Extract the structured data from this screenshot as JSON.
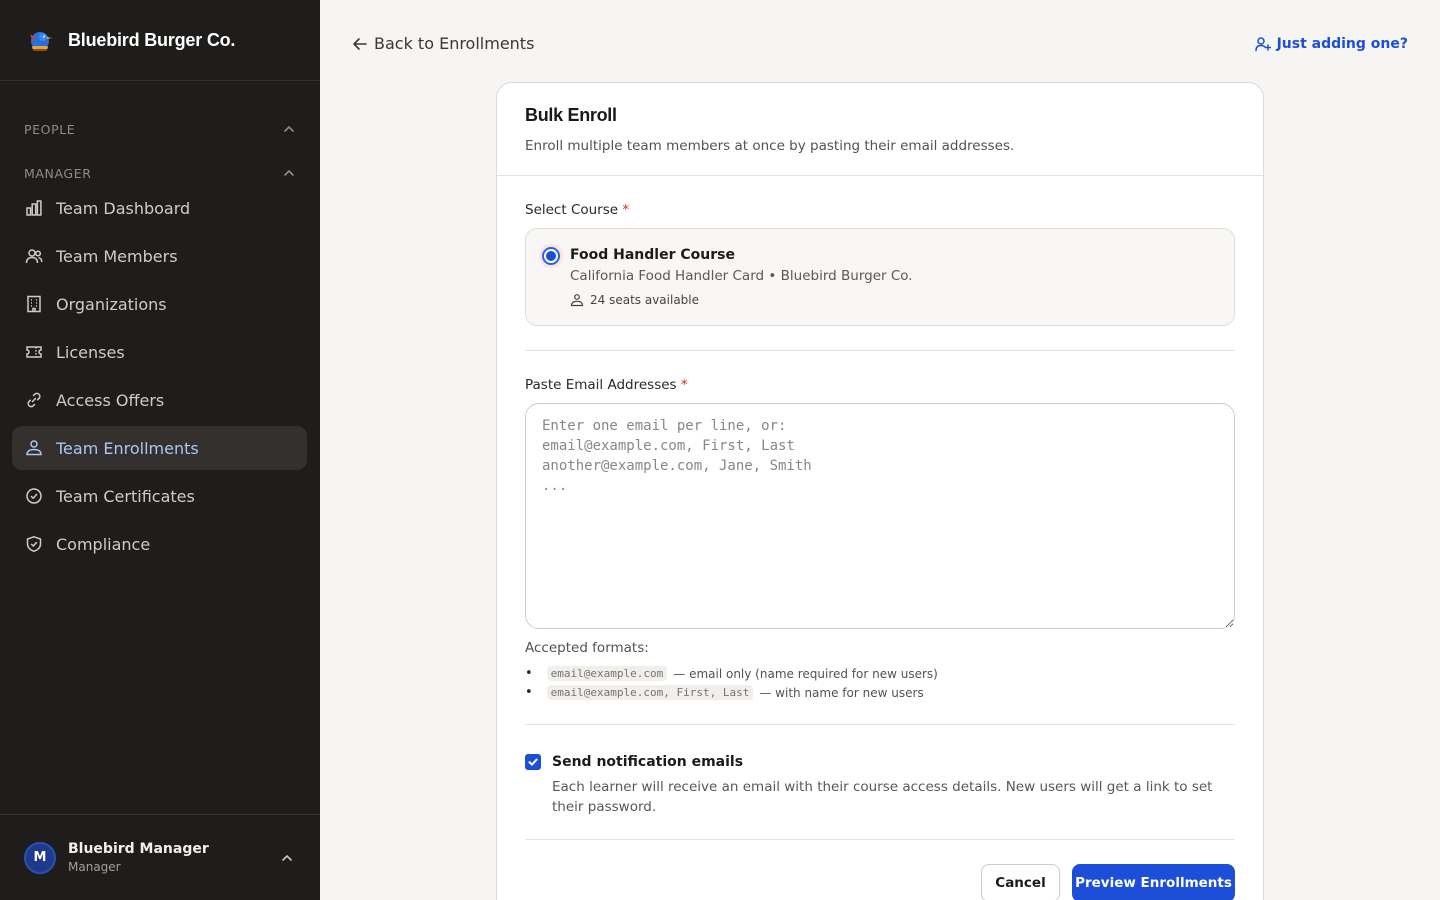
{
  "brand": {
    "name": "Bluebird Burger Co."
  },
  "sidebar": {
    "sections": [
      {
        "label": "PEOPLE"
      },
      {
        "label": "MANAGER"
      }
    ],
    "items": [
      {
        "label": "Team Dashboard",
        "icon": "bar-chart-icon"
      },
      {
        "label": "Team Members",
        "icon": "users-icon"
      },
      {
        "label": "Organizations",
        "icon": "building-icon"
      },
      {
        "label": "Licenses",
        "icon": "ticket-icon"
      },
      {
        "label": "Access Offers",
        "icon": "link-icon"
      },
      {
        "label": "Team Enrollments",
        "icon": "enrollments-icon",
        "active": true
      },
      {
        "label": "Team Certificates",
        "icon": "check-circle-icon"
      },
      {
        "label": "Compliance",
        "icon": "shield-check-icon"
      }
    ],
    "user": {
      "initial": "M",
      "name": "Bluebird Manager",
      "role": "Manager"
    }
  },
  "topbar": {
    "back_label": "Back to Enrollments",
    "just_adding_label": "Just adding one?"
  },
  "card": {
    "title": "Bulk Enroll",
    "subtitle": "Enroll multiple team members at once by pasting their email addresses.",
    "course_label": "Select Course",
    "course": {
      "title": "Food Handler Course",
      "subtitle": "California Food Handler Card • Bluebird Burger Co.",
      "seats": "24 seats available",
      "selected": true
    },
    "emails_label": "Paste Email Addresses",
    "emails_value": "",
    "emails_placeholder": "Enter one email per line, or:\nemail@example.com, First, Last\nanother@example.com, Jane, Smith\n...",
    "formats_title": "Accepted formats:",
    "formats": [
      {
        "code": "email@example.com",
        "desc": "— email only (name required for new users)"
      },
      {
        "code": "email@example.com, First, Last",
        "desc": "— with name for new users"
      }
    ],
    "notify": {
      "checked": true,
      "title": "Send notification emails",
      "desc": "Each learner will receive an email with their course access details. New users will get a link to set their password."
    },
    "cancel_label": "Cancel",
    "preview_label": "Preview Enrollments"
  },
  "colors": {
    "sidebar_bg": "#1f1d1b",
    "accent": "#1d4ed8",
    "required": "#dc2626",
    "active_nav_text": "#a9c8f2"
  }
}
